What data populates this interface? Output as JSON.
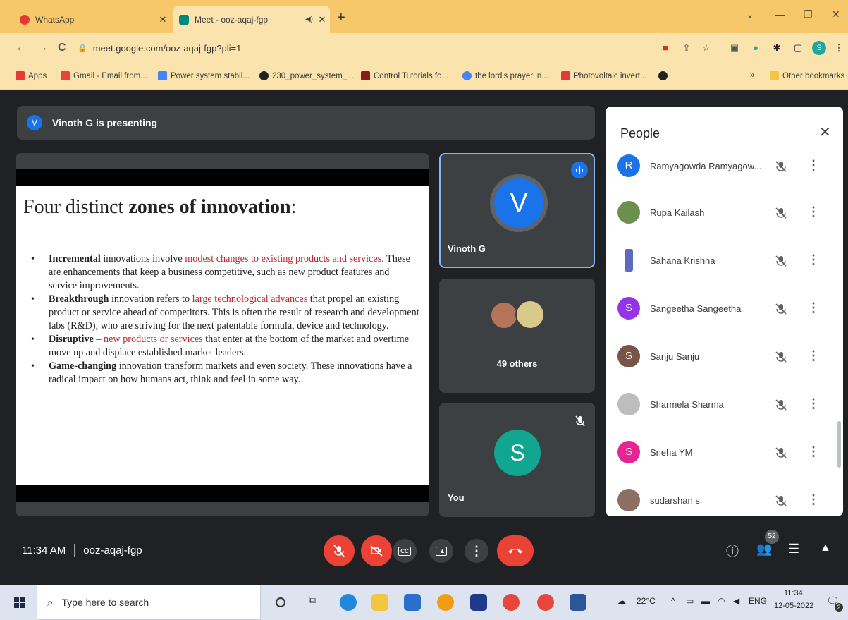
{
  "browser": {
    "tabs": [
      {
        "title": "WhatsApp",
        "color": "#e53935"
      },
      {
        "title": "Meet - ooz-aqaj-fgp",
        "color": "#00897b"
      }
    ],
    "address": "meet.google.com/ooz-aqaj-fgp?pli=1",
    "profile_initial": "S",
    "bookmarks": [
      {
        "label": "Apps",
        "color": "#e53935"
      },
      {
        "label": "Gmail - Email from...",
        "color": "#ea4335"
      },
      {
        "label": "Power system stabil...",
        "color": "#4285f4"
      },
      {
        "label": "230_power_system_...",
        "color": "#222222"
      },
      {
        "label": "Control Tutorials fo...",
        "color": "#8b1a1a"
      },
      {
        "label": "the lord's prayer in...",
        "color": "#4285f4"
      },
      {
        "label": "Photovoltaic invert...",
        "color": "#e53935"
      }
    ],
    "other_bookmarks": "Other bookmarks",
    "more_bookmarks": "»"
  },
  "meet": {
    "presenting_initial": "V",
    "presenting_text": "Vinoth G is presenting",
    "slide": {
      "title_plain": "Four distinct ",
      "title_bold": "zones of innovation",
      "title_end": ":",
      "bullets": [
        {
          "bold": "Incremental",
          "t1": " innovations involve ",
          "red": "modest changes to existing products and services",
          "t2": ". These are enhancements that keep a business competitive, such as new product features and service improvements."
        },
        {
          "bold": "Breakthrough",
          "t1": " innovation refers to ",
          "red": "large technological advances",
          "t2": " that propel an existing product or service ahead of competitors. This is often the result of research and development labs (R&D), who are striving for the next patentable formula, device and technology."
        },
        {
          "bold": "Disruptive",
          "t1": " – ",
          "red": "new products or services",
          "t2": " that enter at the bottom of the market and overtime move up and displace established market leaders."
        },
        {
          "bold": "Game-changing",
          "t1": " innovation transform markets and even society. These innovations have a radical impact on how humans act, think and feel in some way.",
          "red": "",
          "t2": ""
        }
      ]
    },
    "tiles": {
      "vinoth": {
        "initial": "V",
        "name": "Vinoth G"
      },
      "others": {
        "label": "49 others"
      },
      "you": {
        "initial": "S",
        "name": "You"
      }
    },
    "time": "11:34 AM",
    "code": "ooz-aqaj-fgp",
    "people_count": "52"
  },
  "people_panel": {
    "title": "People",
    "participants": [
      {
        "name": "Ramyagowda Ramyagow...",
        "initial": "R",
        "color": "#1a73e8"
      },
      {
        "name": "Rupa Kailash",
        "initial": "",
        "color": "#6d8f4e"
      },
      {
        "name": "Sahana Krishna",
        "initial": "",
        "color": "#5c6bc0"
      },
      {
        "name": "Sangeetha Sangeetha",
        "initial": "S",
        "color": "#9334e6"
      },
      {
        "name": "Sanju Sanju",
        "initial": "S",
        "color": "#795548"
      },
      {
        "name": "Sharmela Sharma",
        "initial": "",
        "color": "#bdbdbd"
      },
      {
        "name": "Sneha YM",
        "initial": "S",
        "color": "#e52592"
      },
      {
        "name": "sudarshan s",
        "initial": "",
        "color": "#8d6e63"
      }
    ]
  },
  "taskbar": {
    "search_placeholder": "Type here to search",
    "temperature": "22°C",
    "language": "ENG",
    "time": "11:34",
    "date": "12-05-2022",
    "notification_count": "2"
  }
}
